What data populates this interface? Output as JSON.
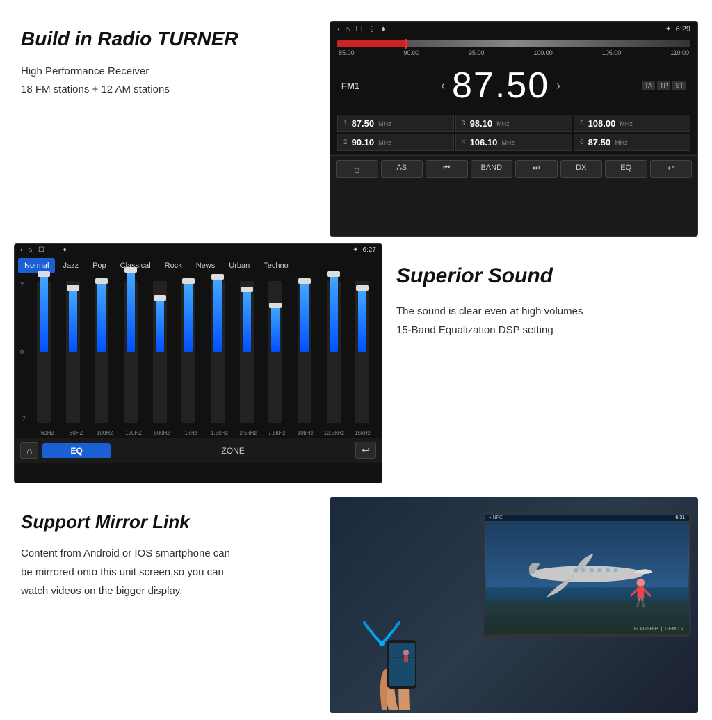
{
  "radio_section": {
    "title": "Build in Radio TURNER",
    "line1": "High Performance Receiver",
    "line2": "18 FM stations + 12 AM stations",
    "screen": {
      "status_bar": {
        "left_icons": "‹  ⌂  ☐  ⋮  ♦",
        "time": "6:29",
        "bt_icon": "✦"
      },
      "freq_labels": [
        "85.00",
        "90.00",
        "95.00",
        "100.00",
        "105.00",
        "110.00"
      ],
      "fm_label": "FM1",
      "current_freq": "87.50",
      "badges": [
        "TA",
        "TP",
        "ST"
      ],
      "presets": [
        {
          "num": "1",
          "freq": "87.50",
          "unit": "MHz"
        },
        {
          "num": "3",
          "freq": "98.10",
          "unit": "MHz"
        },
        {
          "num": "5",
          "freq": "108.00",
          "unit": "MHz"
        },
        {
          "num": "2",
          "freq": "90.10",
          "unit": "MHz"
        },
        {
          "num": "4",
          "freq": "106.10",
          "unit": "MHz"
        },
        {
          "num": "6",
          "freq": "87.50",
          "unit": "MHz"
        }
      ],
      "toolbar": [
        "⌂",
        "AS",
        "⏮",
        "BAND",
        "⏭",
        "DX",
        "EQ",
        "↩"
      ]
    }
  },
  "eq_section": {
    "screen": {
      "status_bar_left": "‹  ⌂  ☐  ⋮  ♦",
      "status_bar_time": "6:27",
      "tabs": [
        "Normal",
        "Jazz",
        "Pop",
        "Classical",
        "Rock",
        "News",
        "Urban",
        "Techno"
      ],
      "active_tab": "Normal",
      "y_labels": [
        "7",
        "",
        "0",
        "",
        "-7"
      ],
      "bands": [
        {
          "label": "60HZ",
          "height_pct": 55
        },
        {
          "label": "80HZ",
          "height_pct": 45
        },
        {
          "label": "100HZ",
          "height_pct": 50
        },
        {
          "label": "120HZ",
          "height_pct": 60
        },
        {
          "label": "500HZ",
          "height_pct": 40
        },
        {
          "label": "1kHz",
          "height_pct": 50
        },
        {
          "label": "1.5kHz",
          "height_pct": 55
        },
        {
          "label": "2.5kHz",
          "height_pct": 45
        },
        {
          "label": "7.5kHz",
          "height_pct": 35
        },
        {
          "label": "10kHz",
          "height_pct": 50
        },
        {
          "label": "12.5kHz",
          "height_pct": 55
        },
        {
          "label": "15kHz",
          "height_pct": 45
        }
      ],
      "bottom": {
        "home": "⌂",
        "eq_label": "EQ",
        "zone_label": "ZONE",
        "back": "↩"
      }
    }
  },
  "sound_section": {
    "title": "Superior Sound",
    "line1": "The sound is clear even at high volumes",
    "line2": "15-Band Equalization DSP setting"
  },
  "mirror_section": {
    "title": "Support Mirror Link",
    "line1": "Content from Android or IOS smartphone can",
    "line2": "be mirrored onto this unit screen,so you can",
    "line3": "watch videos on the  bigger display.",
    "screen": {
      "time": "6:31",
      "brand1": "FLAGSHIP",
      "brand2": "GEM TV"
    }
  }
}
